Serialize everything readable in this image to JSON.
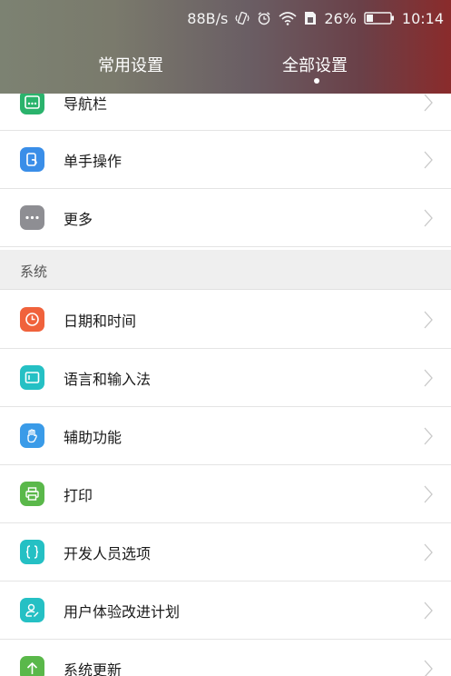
{
  "status_bar": {
    "speed": "88B/s",
    "battery": "26%",
    "time": "10:14"
  },
  "tabs": [
    {
      "label": "常用设置",
      "active": false
    },
    {
      "label": "全部设置",
      "active": true
    }
  ],
  "items_top": [
    {
      "label": "导航栏",
      "icon": "navbar-icon",
      "color": "#2ab36c"
    },
    {
      "label": "单手操作",
      "icon": "one-hand-icon",
      "color": "#3a8ee8"
    },
    {
      "label": "更多",
      "icon": "more-icon",
      "color": "#8e8e93"
    }
  ],
  "section": {
    "label": "系统"
  },
  "items_system": [
    {
      "label": "日期和时间",
      "icon": "clock-icon",
      "color": "#f0623c"
    },
    {
      "label": "语言和输入法",
      "icon": "keyboard-icon",
      "color": "#25c0c4"
    },
    {
      "label": "辅助功能",
      "icon": "hand-icon",
      "color": "#3a9be8"
    },
    {
      "label": "打印",
      "icon": "printer-icon",
      "color": "#5ab84a"
    },
    {
      "label": "开发人员选项",
      "icon": "braces-icon",
      "color": "#25c0c4"
    },
    {
      "label": "用户体验改进计划",
      "icon": "user-edit-icon",
      "color": "#25c0c4"
    },
    {
      "label": "系统更新",
      "icon": "arrow-up-icon",
      "color": "#5ab84a"
    }
  ]
}
